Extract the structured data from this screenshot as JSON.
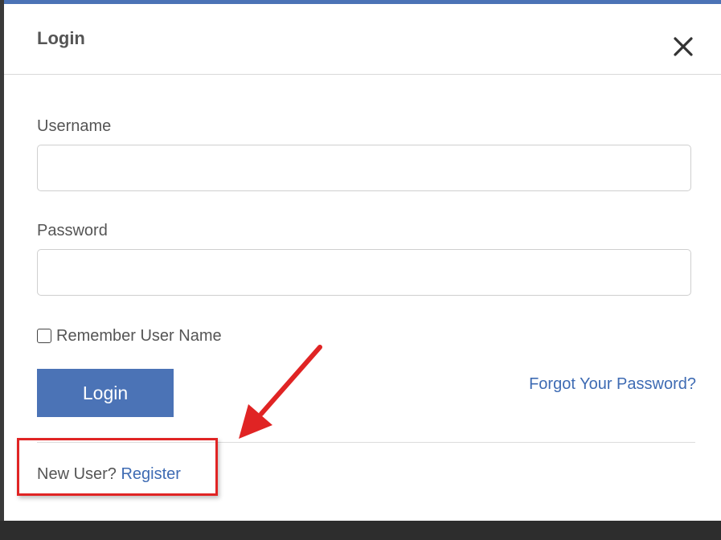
{
  "modal": {
    "title": "Login",
    "close_icon": "close-icon",
    "accent_color": "#4b73b6"
  },
  "form": {
    "username_label": "Username",
    "username_value": "",
    "password_label": "Password",
    "password_value": "",
    "remember_label": "Remember User Name",
    "remember_checked": false,
    "login_label": "Login",
    "forgot_label": "Forgot Your Password?"
  },
  "footer": {
    "new_user_text": "New User?",
    "register_label": "Register"
  },
  "annotation": {
    "color": "#e02424",
    "arrow_icon": "red-arrow-icon"
  }
}
